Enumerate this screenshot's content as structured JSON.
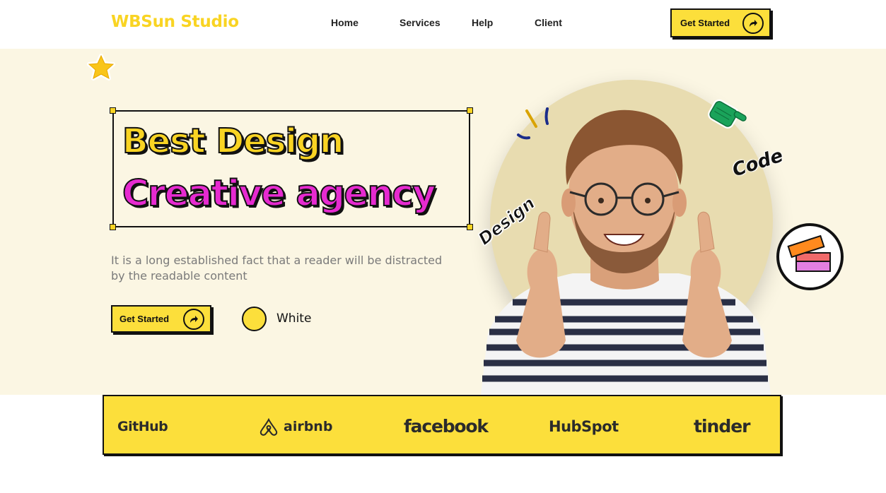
{
  "header": {
    "logo": "WBSun Studio",
    "nav": [
      {
        "label": "Home"
      },
      {
        "label": "Services"
      },
      {
        "label": "Help"
      },
      {
        "label": "Client"
      }
    ],
    "cta_label": "Get Started"
  },
  "hero": {
    "title_line1": "Best Design",
    "title_line2": "Creative agency",
    "description": "It is a long established fact that a reader will be distracted by the readable content",
    "cta_label": "Get Started",
    "swatch_label": "White",
    "sticker_design": "Design",
    "sticker_code": "Code"
  },
  "brands": [
    "GitHub",
    "airbnb",
    "facebook",
    "HubSpot",
    "tinder"
  ],
  "colors": {
    "accent_yellow": "#fcdf3b",
    "magenta": "#e62ad0",
    "hero_bg": "#fbf6e3",
    "circle_bg": "#e8dcb0"
  }
}
